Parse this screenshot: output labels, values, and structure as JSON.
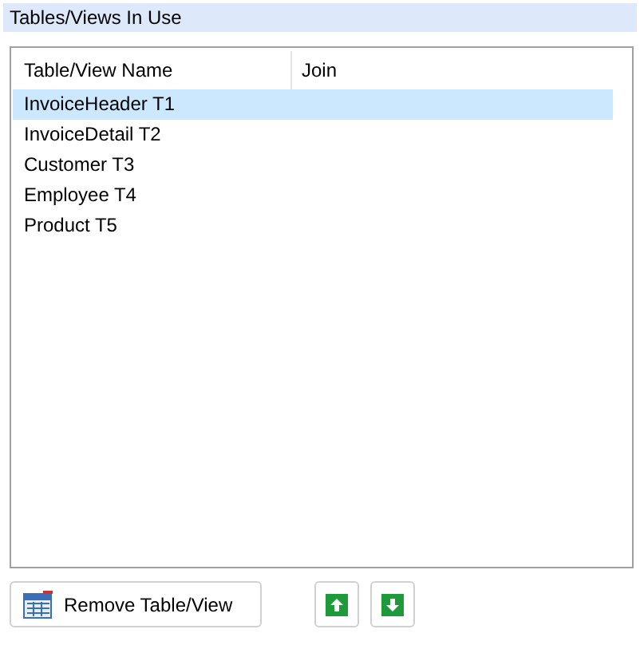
{
  "section": {
    "title": "Tables/Views In Use"
  },
  "table": {
    "columns": [
      "Table/View Name",
      "Join"
    ],
    "rows": [
      {
        "name": "InvoiceHeader T1",
        "selected": true
      },
      {
        "name": "InvoiceDetail T2",
        "selected": false
      },
      {
        "name": "Customer T3",
        "selected": false
      },
      {
        "name": "Employee T4",
        "selected": false
      },
      {
        "name": "Product T5",
        "selected": false
      }
    ]
  },
  "buttons": {
    "remove": "Remove Table/View"
  }
}
